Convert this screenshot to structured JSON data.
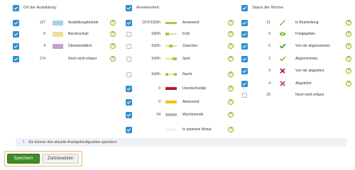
{
  "left": {
    "title": "Ort der Ausbildung:",
    "items": [
      {
        "count": "127",
        "label": "Ausbildungsbetrieb",
        "color": "#a9d0e8",
        "checked": true
      },
      {
        "count": "8",
        "label": "Berufsschule",
        "color": "#f1dd9f",
        "checked": true
      },
      {
        "count": "4",
        "label": "Überbetrieblich",
        "color": "#c0a3cf",
        "checked": true
      },
      {
        "count": "174",
        "label": "Noch nicht erfasst",
        "color": "",
        "checked": true
      }
    ]
  },
  "middle": {
    "title": "Anwesenheit:",
    "items": [
      {
        "count": "1374/1559h",
        "label": "Anwesend",
        "color": "#a8c83a",
        "checked": true
      },
      {
        "count": "0d/0h",
        "label": "Früh",
        "color": "#a8c83a",
        "checked": false
      },
      {
        "count": "0d/0h",
        "label": "Zwischen",
        "color": "#a8c83a",
        "checked": false
      },
      {
        "count": "0d/0h",
        "label": "Spät",
        "color": "#a8c83a",
        "checked": false
      },
      {
        "count": "0d/0h",
        "label": "Nacht",
        "color": "#a8c83a",
        "checked": false
      },
      {
        "count": "0",
        "label": "Unentschuldigt",
        "color": "#c8102e",
        "checked": true
      },
      {
        "count": "0",
        "label": "Abwesend",
        "color": "#f2c200",
        "checked": true
      },
      {
        "count": "54",
        "label": "Wochenende",
        "color": "#bdbdbd",
        "checked": true
      },
      {
        "count": "",
        "label": "In anderem Monat",
        "color": "#f2f2f2",
        "checked": true
      }
    ]
  },
  "right": {
    "title": "Status der Woche:",
    "items": [
      {
        "count": "21",
        "label": "In Bearbeitung",
        "icon": "pencil-icon",
        "checked": true
      },
      {
        "count": "0",
        "label": "Freigegeben",
        "icon": "eye-icon",
        "checked": true
      },
      {
        "count": "0",
        "label": "Von mir abgenommen",
        "icon": "check-icon",
        "checked": true
      },
      {
        "count": "2",
        "label": "Abgenommen",
        "icon": "check-icon",
        "checked": true
      },
      {
        "count": "0",
        "label": "Von mir abgelehnt",
        "icon": "cross-icon",
        "checked": true
      },
      {
        "count": "4",
        "label": "Abgelehnt",
        "icon": "cross-outline-icon",
        "checked": true
      },
      {
        "count": "25",
        "label": "Noch nicht erfasst",
        "icon": "",
        "checked": false
      }
    ]
  },
  "info": {
    "text": "Sie können Ihre aktuelle Anzeigekonfiguration speichern."
  },
  "buttons": {
    "save": "Speichern",
    "reset": "Zurücksetzen"
  },
  "colors": {
    "accent": "#2f8fcf",
    "save": "#3f8d26",
    "focus_outline": "#f4b06a",
    "help": "#86b625"
  }
}
